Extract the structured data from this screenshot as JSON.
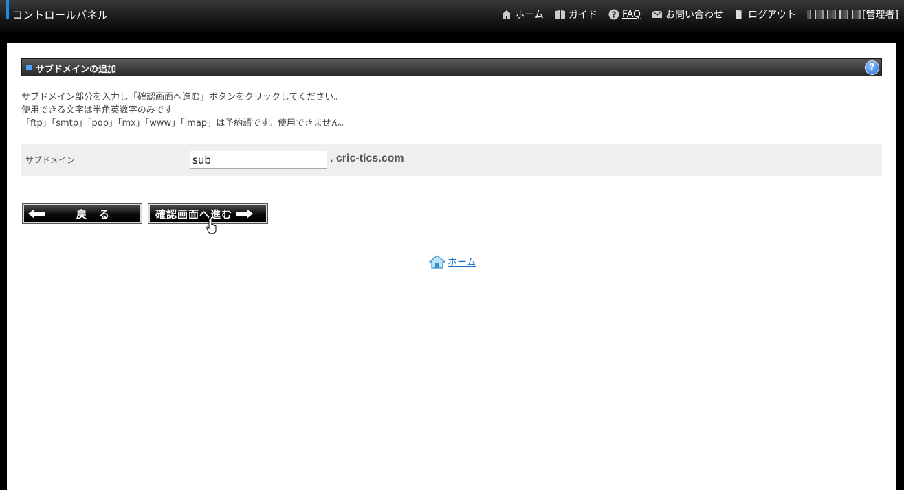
{
  "header": {
    "app_title": "コントロールパネル",
    "nav": [
      {
        "icon": "home-icon",
        "label": "ホーム"
      },
      {
        "icon": "book-icon",
        "label": "ガイド"
      },
      {
        "icon": "question-icon",
        "label": "FAQ"
      },
      {
        "icon": "mail-icon",
        "label": "お問い合わせ"
      },
      {
        "icon": "logout-door-icon",
        "label": "ログアウト"
      }
    ],
    "user_role": "[管理者]"
  },
  "section": {
    "title": "サブドメインの追加",
    "help_symbol": "?"
  },
  "description": {
    "line1": "サブドメイン部分を入力し「確認画面へ進む」ボタンをクリックしてください。",
    "line2": "使用できる文字は半角英数字のみです。",
    "line3": "「ftp」「smtp」「pop」「mx」「www」「imap」は予約語です。使用できません。"
  },
  "form": {
    "label": "サブドメイン",
    "value": "sub",
    "domain_suffix": ". cric-tics.com"
  },
  "buttons": {
    "back": "戻る",
    "confirm": "確認画面へ進む"
  },
  "footer": {
    "home_link": "ホーム"
  },
  "colors": {
    "accent": "#1d8be8",
    "link": "#1a6fc4"
  }
}
